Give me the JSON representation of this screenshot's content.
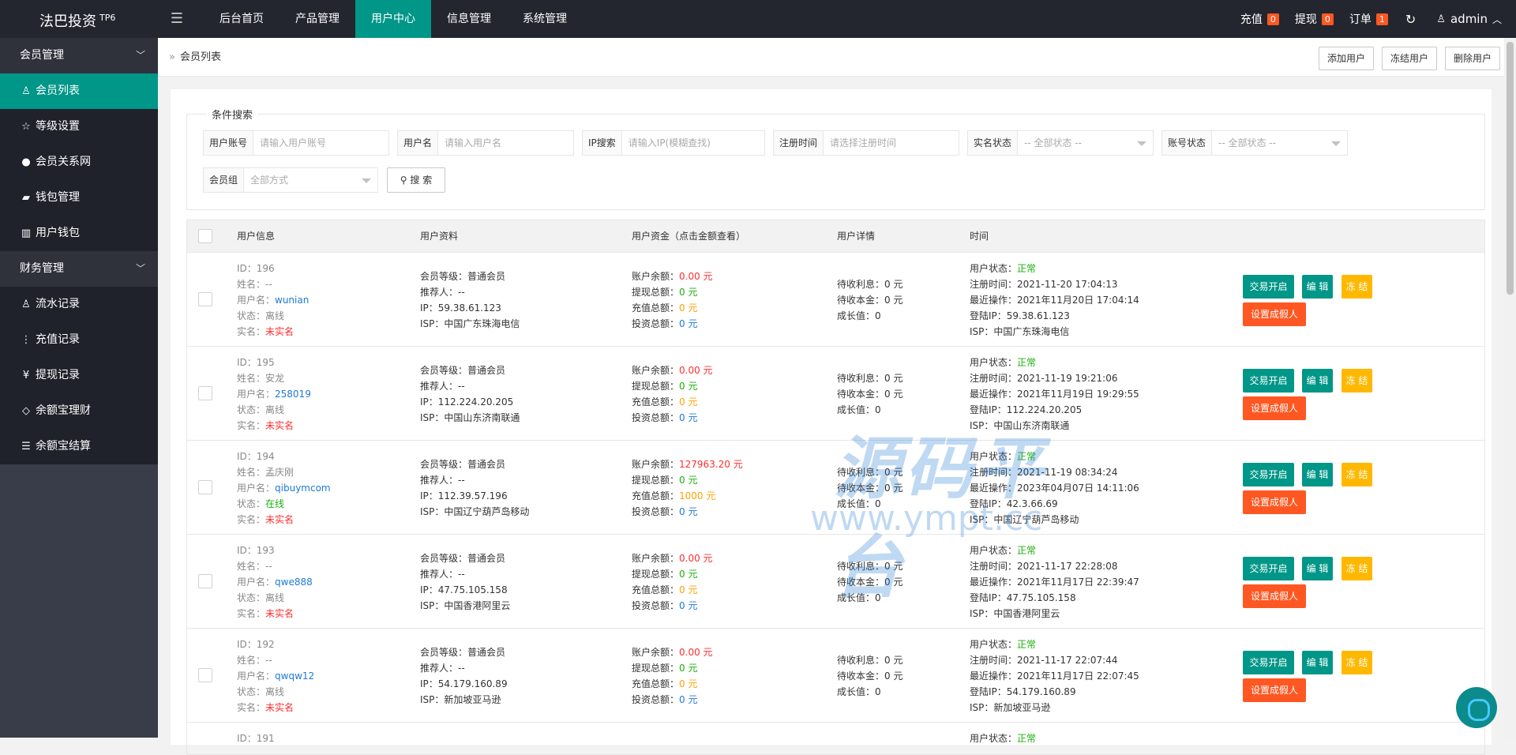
{
  "app": {
    "title": "法巴投资",
    "version": "TP6"
  },
  "nav": {
    "items": [
      "后台首页",
      "产品管理",
      "用户中心",
      "信息管理",
      "系统管理"
    ],
    "active": 2
  },
  "topright": {
    "recharge": "充值",
    "recharge_count": "0",
    "withdraw": "提现",
    "withdraw_count": "0",
    "order": "订单",
    "order_count": "1",
    "user": "admin"
  },
  "sidebar": {
    "group1": "会员管理",
    "items1": [
      {
        "label": "会员列表",
        "icon": "user-icon"
      },
      {
        "label": "等级设置",
        "icon": "star-icon"
      },
      {
        "label": "会员关系网",
        "icon": "users-icon"
      },
      {
        "label": "钱包管理",
        "icon": "book-icon"
      },
      {
        "label": "用户钱包",
        "icon": "wallet-icon"
      }
    ],
    "group2": "财务管理",
    "items2": [
      {
        "label": "流水记录",
        "icon": "user-icon"
      },
      {
        "label": "充值记录",
        "icon": "ellipsis-icon"
      },
      {
        "label": "提现记录",
        "icon": "yen-icon"
      },
      {
        "label": "余额宝理财",
        "icon": "diamond-icon"
      },
      {
        "label": "余额宝结算",
        "icon": "list-icon"
      }
    ]
  },
  "breadcrumb": "会员列表",
  "toolbar": {
    "add": "添加用户",
    "freeze": "冻结用户",
    "delete": "删除用户"
  },
  "search": {
    "legend": "条件搜索",
    "account_label": "用户账号",
    "account_ph": "请输入用户账号",
    "name_label": "用户名",
    "name_ph": "请输入用户名",
    "ip_label": "IP搜索",
    "ip_ph": "请输入IP(模糊查找)",
    "regtime_label": "注册时间",
    "regtime_ph": "请选择注册时间",
    "realname_label": "实名状态",
    "realname_val": "-- 全部状态 --",
    "status_label": "账号状态",
    "status_val": "-- 全部状态 --",
    "group_label": "会员组",
    "group_val": "全部方式",
    "button": "搜 索"
  },
  "table": {
    "headers": [
      "用户信息",
      "用户资料",
      "用户资金（点击金额查看）",
      "用户详情",
      "时间"
    ],
    "labels": {
      "id": "ID：",
      "realname": "姓名：",
      "username": "用户名：",
      "state": "状态：",
      "verified": "实名：",
      "level": "会员等级：",
      "referrer": "推荐人：",
      "ip": "IP：",
      "isp": "ISP：",
      "balance": "账户余额：",
      "withdraw_total": "提现总额：",
      "recharge_total": "充值总额：",
      "invest_total": "投资总额：",
      "pending_interest": "待收利息：",
      "pending_principal": "待收本金：",
      "growth": "成长值：",
      "user_status": "用户状态：",
      "reg_time": "注册时间：",
      "last_op": "最近操作：",
      "login_ip": "登陆IP："
    },
    "buttons": {
      "trade": "交易开启",
      "edit": "编 辑",
      "freeze": "冻 结",
      "fake": "设置成假人"
    },
    "rows": [
      {
        "id": "196",
        "realname": "--",
        "username": "wunian",
        "state": "离线",
        "verified": "未实名",
        "level": "普通会员",
        "referrer": "--",
        "ip": "59.38.61.123",
        "isp": "中国广东珠海电信",
        "balance": "0.00 元",
        "withdraw_total": "0 元",
        "recharge_total": "0 元",
        "invest_total": "0 元",
        "pending_interest": "0 元",
        "pending_principal": "0 元",
        "growth": "0",
        "user_status": "正常",
        "reg_time": "2021-11-20 17:04:13",
        "last_op": "2021年11月20日 17:04:14",
        "login_ip": "59.38.61.123",
        "isp2": "中国广东珠海电信"
      },
      {
        "id": "195",
        "realname": "安龙",
        "username": "258019",
        "state": "离线",
        "verified": "未实名",
        "level": "普通会员",
        "referrer": "--",
        "ip": "112.224.20.205",
        "isp": "中国山东济南联通",
        "balance": "0.00 元",
        "withdraw_total": "0 元",
        "recharge_total": "0 元",
        "invest_total": "0 元",
        "pending_interest": "0 元",
        "pending_principal": "0 元",
        "growth": "0",
        "user_status": "正常",
        "reg_time": "2021-11-19 19:21:06",
        "last_op": "2021年11月19日 19:29:55",
        "login_ip": "112.224.20.205",
        "isp2": "中国山东济南联通"
      },
      {
        "id": "194",
        "realname": "孟庆刚",
        "username": "qibuymcom",
        "state": "在线",
        "verified": "未实名",
        "level": "普通会员",
        "referrer": "--",
        "ip": "112.39.57.196",
        "isp": "中国辽宁葫芦岛移动",
        "balance": "127963.20 元",
        "withdraw_total": "0 元",
        "recharge_total": "1000 元",
        "invest_total": "0 元",
        "pending_interest": "0 元",
        "pending_principal": "0 元",
        "growth": "0",
        "user_status": "正常",
        "reg_time": "2021-11-19 08:34:24",
        "last_op": "2023年04月07日 14:11:06",
        "login_ip": "42.3.66.69",
        "isp2": "中国辽宁葫芦岛移动"
      },
      {
        "id": "193",
        "realname": "--",
        "username": "qwe888",
        "state": "离线",
        "verified": "未实名",
        "level": "普通会员",
        "referrer": "--",
        "ip": "47.75.105.158",
        "isp": "中国香港阿里云",
        "balance": "0.00 元",
        "withdraw_total": "0 元",
        "recharge_total": "0 元",
        "invest_total": "0 元",
        "pending_interest": "0 元",
        "pending_principal": "0 元",
        "growth": "0",
        "user_status": "正常",
        "reg_time": "2021-11-17 22:28:08",
        "last_op": "2021年11月17日 22:39:47",
        "login_ip": "47.75.105.158",
        "isp2": "中国香港阿里云"
      },
      {
        "id": "192",
        "realname": "--",
        "username": "qwqw12",
        "state": "离线",
        "verified": "未实名",
        "level": "普通会员",
        "referrer": "--",
        "ip": "54.179.160.89",
        "isp": "新加坡亚马逊",
        "balance": "0.00 元",
        "withdraw_total": "0 元",
        "recharge_total": "0 元",
        "invest_total": "0 元",
        "pending_interest": "0 元",
        "pending_principal": "0 元",
        "growth": "0",
        "user_status": "正常",
        "reg_time": "2021-11-17 22:07:44",
        "last_op": "2021年11月17日 22:07:45",
        "login_ip": "54.179.160.89",
        "isp2": "新加坡亚马逊"
      }
    ],
    "partial_row": {
      "id": "191",
      "user_status": "正常"
    }
  },
  "watermark": {
    "line1": "源码平台",
    "line2": "www.ympt.cc"
  },
  "colors": {
    "brand": "#009688",
    "topbar": "#23262e",
    "sidebar": "#393d49",
    "danger": "#ff5722",
    "warn": "#ffb800"
  }
}
